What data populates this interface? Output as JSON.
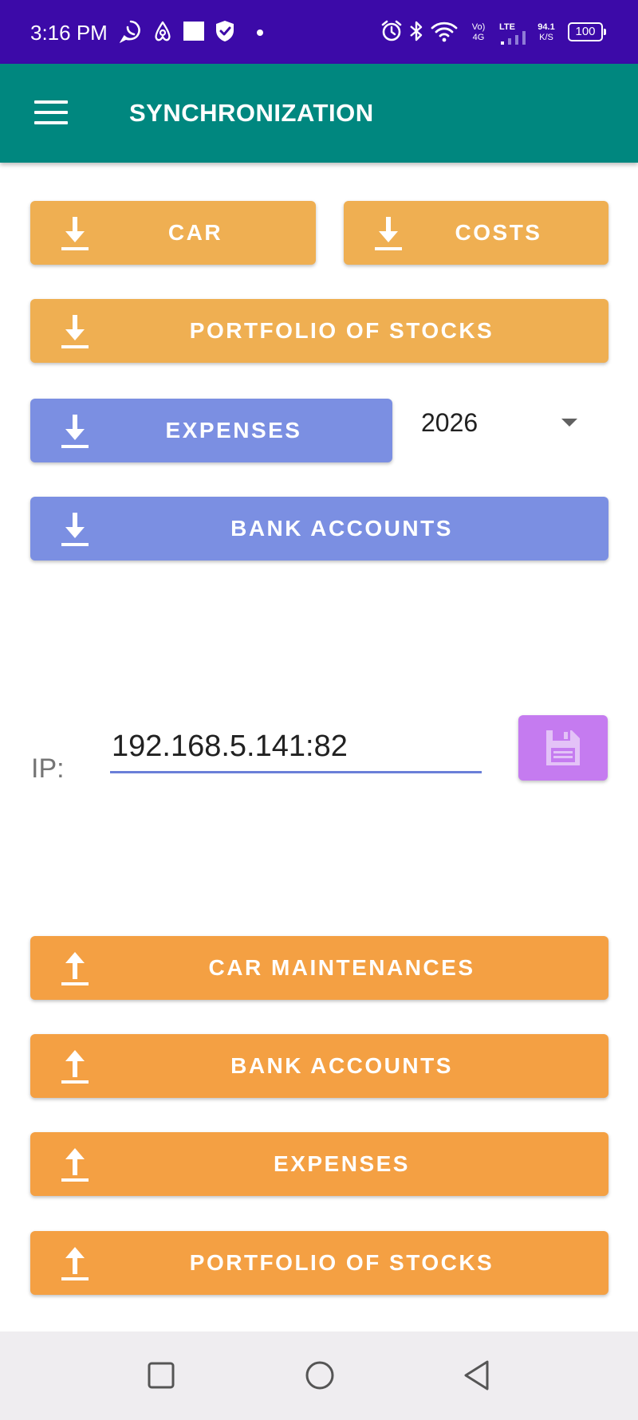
{
  "status_bar": {
    "time": "3:16 PM",
    "net_top": "Vo)",
    "net_bottom": "4G",
    "lte": "LTE",
    "speed_top": "94.1",
    "speed_bottom": "K/S",
    "battery": "100",
    "icons": [
      "whatsapp-icon",
      "airbnb-icon",
      "square-icon",
      "shield-icon",
      "alarm-icon",
      "bluetooth-icon",
      "wifi-icon",
      "signal-icon"
    ]
  },
  "app_bar": {
    "title": "SYNCHRONIZATION",
    "menu_icon": "menu-icon"
  },
  "download": {
    "car": "CAR",
    "costs": "COSTS",
    "portfolio": "PORTFOLIO OF STOCKS",
    "expenses": "EXPENSES",
    "bank_accounts": "BANK ACCOUNTS",
    "icon": "download-icon"
  },
  "year_select": {
    "value": "2026"
  },
  "ip": {
    "label": "IP:",
    "value": "192.168.5.141:82",
    "save_icon": "save-icon"
  },
  "upload": {
    "car_maintenances": "CAR MAINTENANCES",
    "bank_accounts": "BANK ACCOUNTS",
    "expenses": "EXPENSES",
    "portfolio": "PORTFOLIO OF STOCKS",
    "icon": "upload-icon"
  },
  "colors": {
    "status_bar": "#3c0aa8",
    "app_bar": "#00877f",
    "download_button": "#efaf52",
    "download_button_alt": "#7b8fe2",
    "upload_button": "#f4a043",
    "save_button": "#c57bf0",
    "input_underline": "#6a7fd8"
  },
  "nav_bar": {
    "buttons": [
      "recent-apps-icon",
      "home-icon",
      "back-icon"
    ]
  }
}
